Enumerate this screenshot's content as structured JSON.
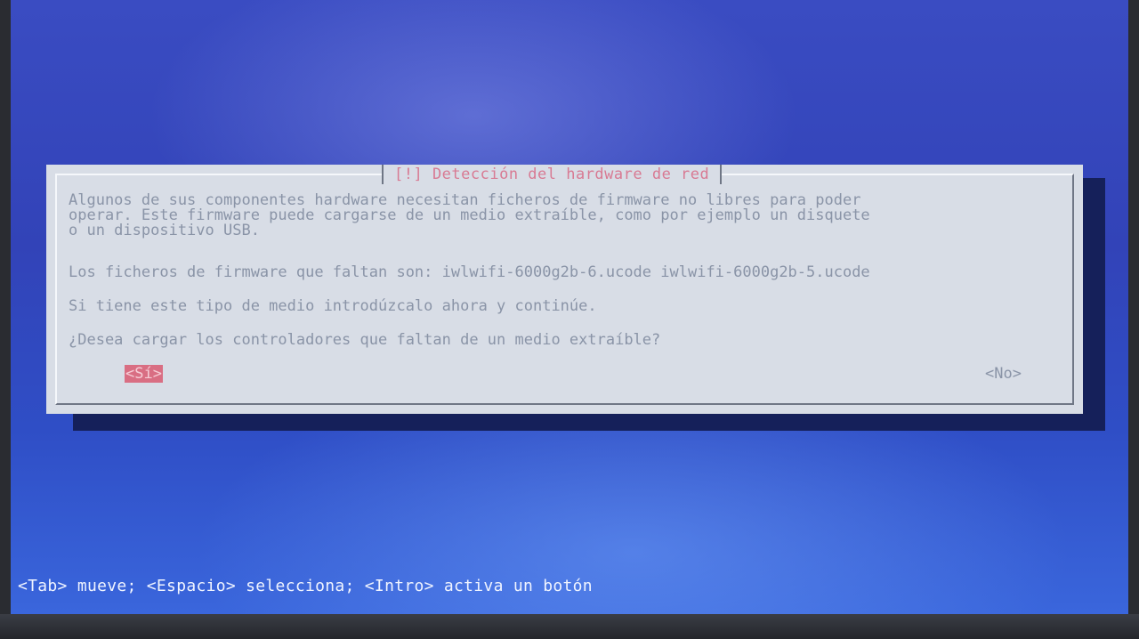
{
  "dialog": {
    "title": "[!] Detección del hardware de red",
    "paragraph1": "Algunos de sus componentes hardware necesitan ficheros de firmware no libres para poder\noperar. Este firmware puede cargarse de un medio extraíble, como por ejemplo un disquete\no un dispositivo USB.",
    "paragraph2": "Los ficheros de firmware que faltan son: iwlwifi-6000g2b-6.ucode iwlwifi-6000g2b-5.ucode",
    "paragraph3": "Si tiene este tipo de medio introdúzcalo ahora y continúe.",
    "question": "¿Desea cargar los controladores que faltan de un medio extraíble?",
    "yes_label": "<Sí>",
    "no_label": "<No>"
  },
  "status_bar": {
    "hint": "<Tab> mueve; <Espacio> selecciona; <Intro> activa un botón"
  },
  "colors": {
    "background": "#3243b8",
    "dialog": "#d8dde6",
    "title": "#d87a93",
    "selected_button": "#d96e83",
    "text": "#8a94a7"
  }
}
